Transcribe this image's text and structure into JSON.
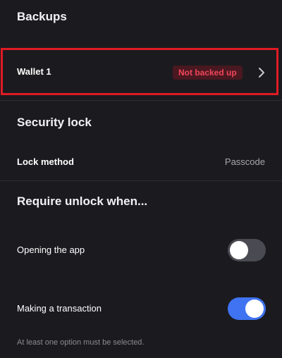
{
  "backups": {
    "title": "Backups",
    "wallet": {
      "label": "Wallet 1",
      "status": "Not backed up"
    }
  },
  "security_lock": {
    "title": "Security lock",
    "lock_method": {
      "label": "Lock method",
      "value": "Passcode"
    }
  },
  "require_unlock": {
    "title": "Require unlock when...",
    "options": [
      {
        "label": "Opening the app",
        "enabled": false
      },
      {
        "label": "Making a transaction",
        "enabled": true
      }
    ],
    "helper": "At least one option must be selected."
  },
  "colors": {
    "background": "#1b1b1f",
    "highlight_border": "#e01b24",
    "badge_text": "#f0465a",
    "toggle_on": "#3f73f2",
    "toggle_off": "#4a4a52"
  },
  "icons": {
    "wallet_row_chevron": "chevron-right-icon"
  }
}
